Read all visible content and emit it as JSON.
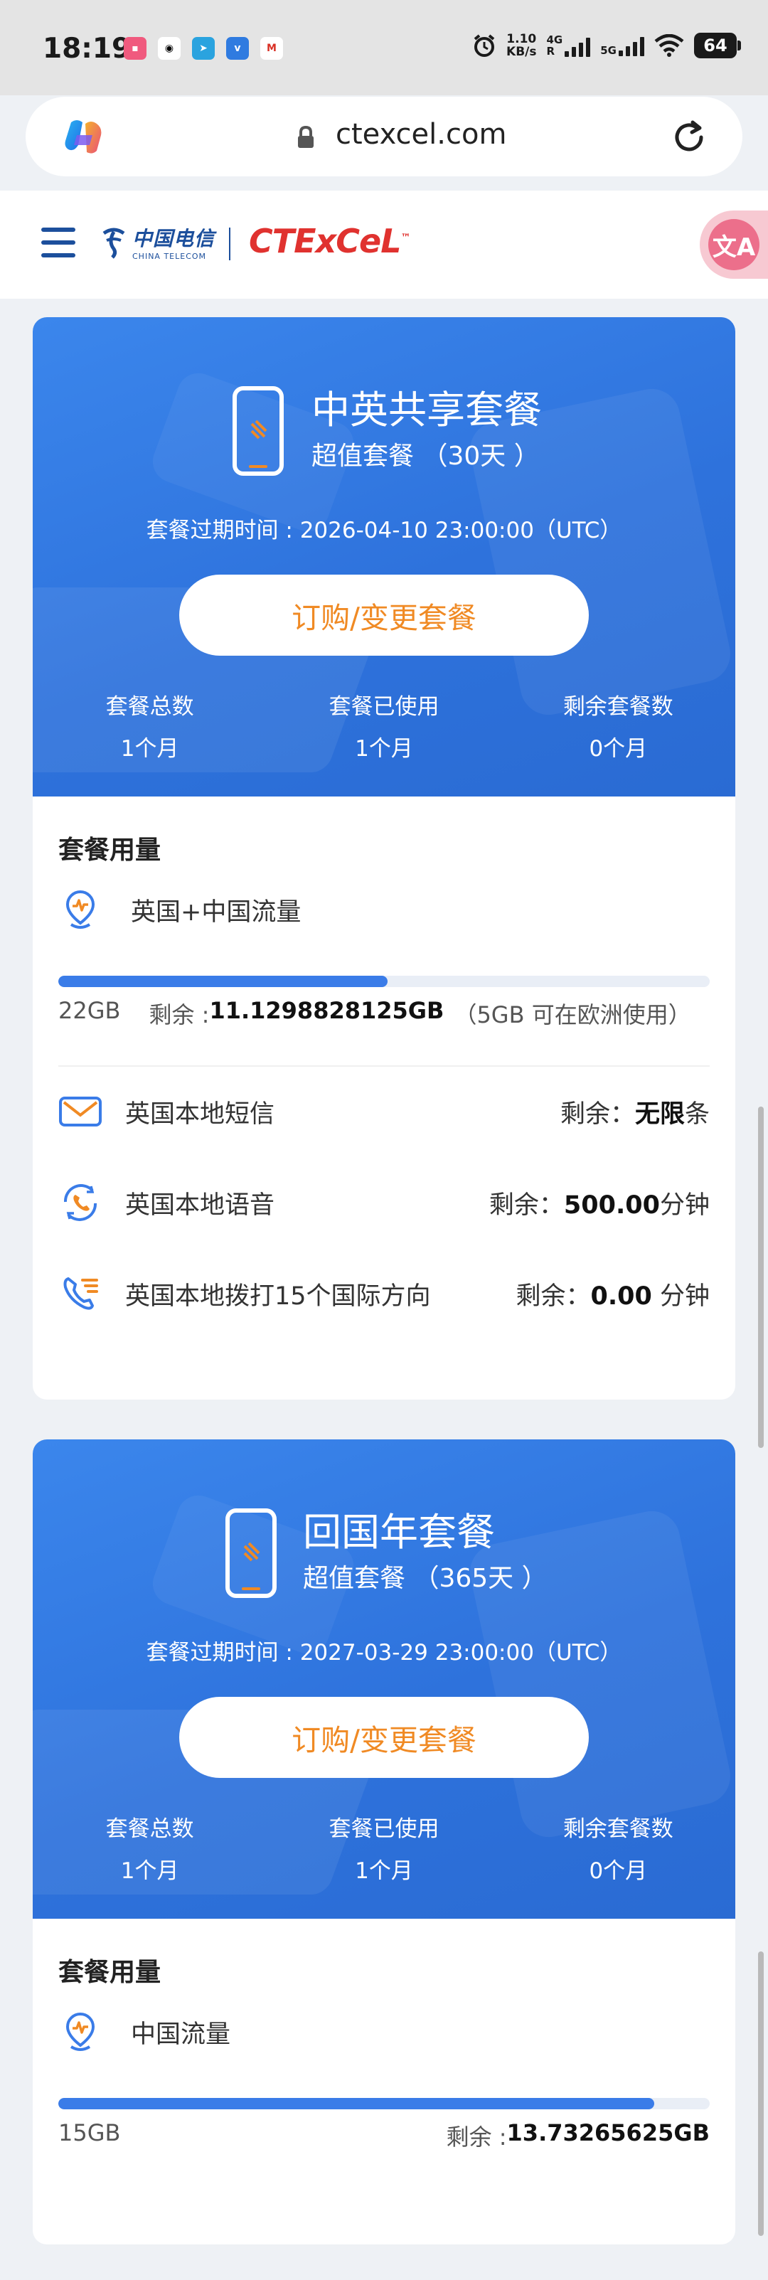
{
  "status_bar": {
    "time": "18:19",
    "speed_value": "1.10",
    "speed_unit": "KB/s",
    "net1": "4G",
    "net1_sub": "R",
    "net2": "5G",
    "battery": "64"
  },
  "browser": {
    "url": "ctexcel.com"
  },
  "site": {
    "ct_logo_text": "中国电信",
    "ct_logo_sub": "CHINA TELECOM",
    "brand": "CTExCeL",
    "tm": "™"
  },
  "plans": [
    {
      "title": "中英共享套餐",
      "subtitle": "超值套餐 （30天 ）",
      "expiry": "套餐过期时间 : 2026-04-10 23:00:00（UTC）",
      "order_button": "订购/变更套餐",
      "stats": [
        {
          "label": "套餐总数",
          "value": "1个月"
        },
        {
          "label": "套餐已使用",
          "value": "1个月"
        },
        {
          "label": "剩余套餐数",
          "value": "0个月"
        }
      ],
      "usage_title": "套餐用量",
      "data_label": "英国+中国流量",
      "data_used_fraction": 0.505,
      "data_total": "22GB",
      "data_remaining_label": "剩余 : ",
      "data_remaining": "11.1298828125GB",
      "data_note": "（5GB 可在欧洲使用）",
      "rows": [
        {
          "label": "英国本地短信",
          "remaining_label": "剩余：",
          "value": "无限",
          "unit": "条"
        },
        {
          "label": "英国本地语音",
          "remaining_label": "剩余：",
          "value": "500.00",
          "unit": "分钟"
        },
        {
          "label": "英国本地拨打15个国际方向",
          "remaining_label": "剩余：",
          "value": "0.00",
          "unit": " 分钟"
        }
      ]
    },
    {
      "title": "回国年套餐",
      "subtitle": "超值套餐 （365天 ）",
      "expiry": "套餐过期时间 : 2027-03-29 23:00:00（UTC）",
      "order_button": "订购/变更套餐",
      "stats": [
        {
          "label": "套餐总数",
          "value": "1个月"
        },
        {
          "label": "套餐已使用",
          "value": "1个月"
        },
        {
          "label": "剩余套餐数",
          "value": "0个月"
        }
      ],
      "usage_title": "套餐用量",
      "data_label": "中国流量",
      "data_used_fraction": 0.915,
      "data_total": "15GB",
      "data_remaining_label": "剩余 : ",
      "data_remaining": "13.73265625GB"
    }
  ]
}
